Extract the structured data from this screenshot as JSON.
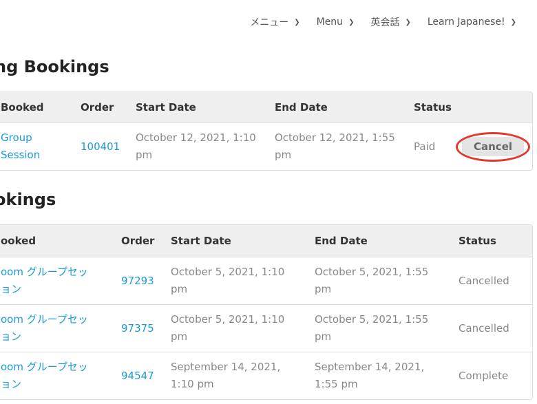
{
  "nav": {
    "items": [
      {
        "label": "メニュー"
      },
      {
        "label": "Menu"
      },
      {
        "label": "英会話"
      },
      {
        "label": "Learn Japanese!"
      }
    ]
  },
  "upcoming": {
    "title": "ng Bookings",
    "headers": {
      "booked": "Booked",
      "order": "Order",
      "start": "Start Date",
      "end": "End Date",
      "status": "Status"
    },
    "rows": [
      {
        "booked_line1": "Group",
        "booked_line2": "Session",
        "order": "100401",
        "start_line1": "October 12, 2021, 1:10",
        "start_line2": "pm",
        "end_line1": "October 12, 2021, 1:55",
        "end_line2": "pm",
        "status": "Paid",
        "action": "Cancel"
      }
    ]
  },
  "past": {
    "title": "okings",
    "headers": {
      "booked": "ooked",
      "order": "Order",
      "start": "Start Date",
      "end": "End Date",
      "status": "Status"
    },
    "rows": [
      {
        "booked_line1": "oom グループセッ",
        "booked_line2": "ョン",
        "order": "97293",
        "start_line1": "October 5, 2021, 1:10",
        "start_line2": "pm",
        "end_line1": "October 5, 2021, 1:55",
        "end_line2": "pm",
        "status": "Cancelled"
      },
      {
        "booked_line1": "oom グループセッ",
        "booked_line2": "ョン",
        "order": "97375",
        "start_line1": "October 5, 2021, 1:10",
        "start_line2": "pm",
        "end_line1": "October 5, 2021, 1:55",
        "end_line2": "pm",
        "status": "Cancelled"
      },
      {
        "booked_line1": "oom グループセッ",
        "booked_line2": "ョン",
        "order": "94547",
        "start_line1": "September 14, 2021,",
        "start_line2": "1:10 pm",
        "end_line1": "September 14, 2021,",
        "end_line2": "1:55 pm",
        "status": "Complete"
      }
    ]
  },
  "colors": {
    "link": "#1a9bd7",
    "highlight_ring": "#e03a2f",
    "header_bg": "#efefef"
  },
  "icons": {
    "dropdown": "chevron-down-icon"
  }
}
